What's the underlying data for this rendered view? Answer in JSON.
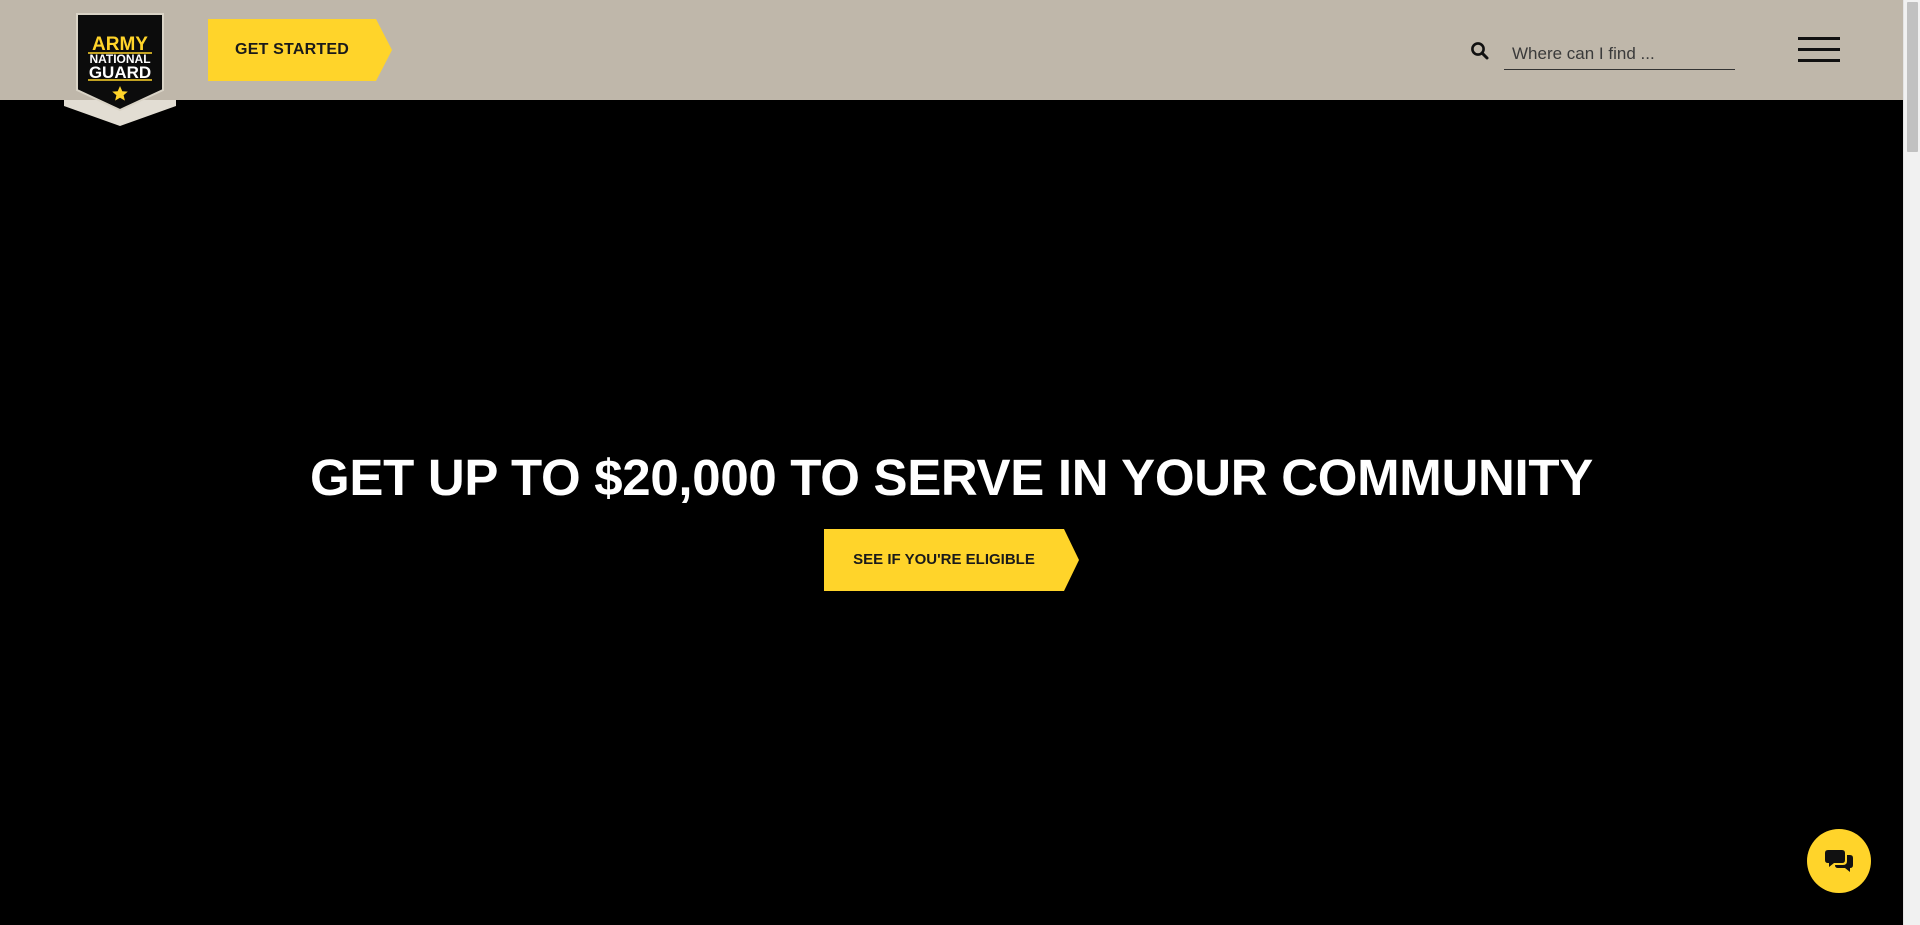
{
  "header": {
    "logo": {
      "line1": "ARMY",
      "line2": "NATIONAL",
      "line3": "GUARD",
      "colors": {
        "shield": "#0c0c0c",
        "text": "#ffffff",
        "accent": "#ffd42a"
      }
    },
    "cta_label": "GET STARTED",
    "search": {
      "icon": "search-icon",
      "placeholder": "Where can I find ..."
    },
    "menu_icon": "hamburger-menu-icon",
    "background": "#bfb7aa"
  },
  "hero": {
    "heading": "GET UP TO $20,000 TO SERVE IN YOUR COMMUNITY",
    "button_label": "SEE IF YOU'RE ELIGIBLE",
    "background": "#000000"
  },
  "chat": {
    "icon": "chat-bubbles-icon",
    "color": "#ffd42a"
  },
  "colors": {
    "accent": "#ffd42a",
    "text_dark": "#1a1a1a"
  }
}
